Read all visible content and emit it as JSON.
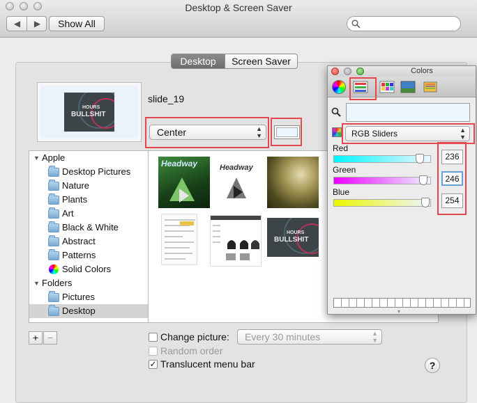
{
  "window": {
    "title": "Desktop & Screen Saver"
  },
  "toolbar": {
    "back_glyph": "◀",
    "forward_glyph": "▶",
    "show_all_label": "Show All",
    "search_placeholder": ""
  },
  "tabs": [
    {
      "label": "Desktop",
      "selected": true
    },
    {
      "label": "Screen Saver",
      "selected": false
    }
  ],
  "preview": {
    "filename": "slide_19",
    "image_text_line1": "HOURS",
    "image_text_line2": "BULLSHIT"
  },
  "position_popup": {
    "value": "Center"
  },
  "background_color": "#ecf6fe",
  "sidebar": {
    "groups": [
      {
        "label": "Apple",
        "items": [
          {
            "label": "Desktop Pictures",
            "icon": "folder-icon"
          },
          {
            "label": "Nature",
            "icon": "folder-icon"
          },
          {
            "label": "Plants",
            "icon": "folder-icon"
          },
          {
            "label": "Art",
            "icon": "folder-icon"
          },
          {
            "label": "Black & White",
            "icon": "folder-icon"
          },
          {
            "label": "Abstract",
            "icon": "folder-icon"
          },
          {
            "label": "Patterns",
            "icon": "folder-icon"
          },
          {
            "label": "Solid Colors",
            "icon": "color-wheel-icon"
          }
        ]
      },
      {
        "label": "Folders",
        "items": [
          {
            "label": "Pictures",
            "icon": "folder-icon"
          },
          {
            "label": "Desktop",
            "icon": "folder-icon",
            "selected": true
          }
        ]
      }
    ]
  },
  "thumbnails": {
    "headway_text": "Headway",
    "slide_text_line1": "HOURS",
    "slide_text_line2": "BULLSHIT"
  },
  "list_buttons": {
    "add": "+",
    "remove": "−"
  },
  "options": {
    "change_picture": {
      "label": "Change picture:",
      "checked": false
    },
    "interval": {
      "value": "Every 30 minutes"
    },
    "random_order": {
      "label": "Random order",
      "checked": false
    },
    "translucent_menu_bar": {
      "label": "Translucent menu bar",
      "checked": true,
      "mark": "✓"
    }
  },
  "help_label": "?",
  "colors_panel": {
    "title": "Colors",
    "mode_popup": "RGB Sliders",
    "sliders": [
      {
        "label": "Red",
        "value": "236",
        "fraction": 0.925
      },
      {
        "label": "Green",
        "value": "246",
        "fraction": 0.965
      },
      {
        "label": "Blue",
        "value": "254",
        "fraction": 0.996
      }
    ]
  },
  "accent_colors": {
    "highlight_box": "#e4484e",
    "selection_gray": "#d4d4d4"
  }
}
